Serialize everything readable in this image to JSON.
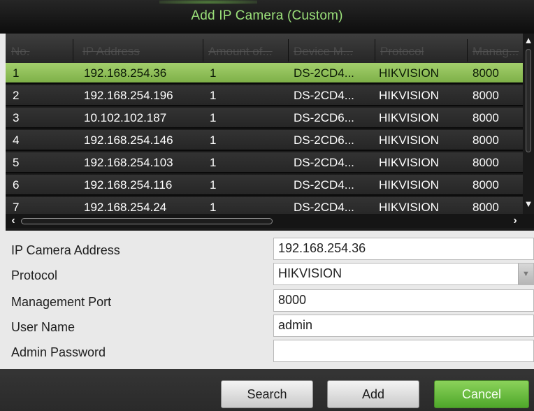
{
  "dialog": {
    "title": "Add IP Camera (Custom)"
  },
  "table": {
    "columns": [
      "No.",
      "IP Address",
      "Amount of...",
      "Device M...",
      "Protocol",
      "Manag..."
    ],
    "selected_row": 0,
    "rows": [
      {
        "no": "1",
        "ip": "192.168.254.36",
        "amount": "1",
        "model": "DS-2CD4...",
        "protocol": "HIKVISION",
        "port": "8000"
      },
      {
        "no": "2",
        "ip": "192.168.254.196",
        "amount": "1",
        "model": "DS-2CD4...",
        "protocol": "HIKVISION",
        "port": "8000"
      },
      {
        "no": "3",
        "ip": "10.102.102.187",
        "amount": "1",
        "model": "DS-2CD6...",
        "protocol": "HIKVISION",
        "port": "8000"
      },
      {
        "no": "4",
        "ip": "192.168.254.146",
        "amount": "1",
        "model": "DS-2CD6...",
        "protocol": "HIKVISION",
        "port": "8000"
      },
      {
        "no": "5",
        "ip": "192.168.254.103",
        "amount": "1",
        "model": "DS-2CD4...",
        "protocol": "HIKVISION",
        "port": "8000"
      },
      {
        "no": "6",
        "ip": "192.168.254.116",
        "amount": "1",
        "model": "DS-2CD4...",
        "protocol": "HIKVISION",
        "port": "8000"
      },
      {
        "no": "7",
        "ip": "192.168.254.24",
        "amount": "1",
        "model": "DS-2CD4...",
        "protocol": "HIKVISION",
        "port": "8000"
      }
    ]
  },
  "form": {
    "ip_label": "IP Camera Address",
    "ip_value": "192.168.254.36",
    "protocol_label": "Protocol",
    "protocol_value": "HIKVISION",
    "port_label": "Management Port",
    "port_value": "8000",
    "user_label": "User Name",
    "user_value": "admin",
    "password_label": "Admin Password",
    "password_value": ""
  },
  "buttons": {
    "search": "Search",
    "add": "Add",
    "cancel": "Cancel"
  },
  "icons": {
    "scroll_up": "chevron-up-icon",
    "scroll_down": "chevron-down-icon",
    "scroll_left": "chevron-left-icon",
    "scroll_right": "chevron-right-icon",
    "dropdown": "triangle-down-icon"
  },
  "colors": {
    "title_text": "#9be07a",
    "selected_row": "#8ebd56",
    "primary_button": "#5fb535"
  }
}
